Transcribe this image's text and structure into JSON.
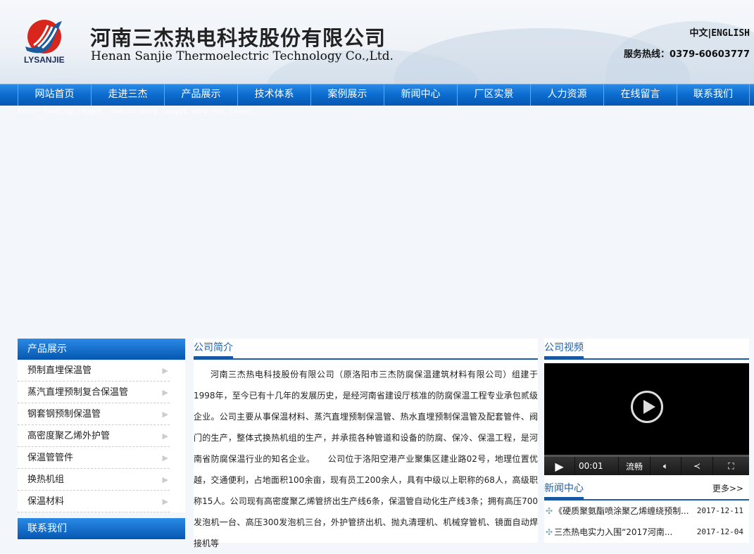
{
  "header": {
    "logo_text": "LYSANJIE",
    "title_cn": "河南三杰热电科技股份有限公司",
    "title_en": "Henan Sanjie Thermoelectric Technology Co.,Ltd.",
    "lang_cn": "中文",
    "lang_sep": "|",
    "lang_en": "ENGLISH",
    "hotline": "服务热线：0379-60603777"
  },
  "nav": [
    "网站首页",
    "走进三杰",
    "产品展示",
    "技术体系",
    "案例展示",
    "新闻中心",
    "厂区实景",
    "人力资源",
    "在线留言",
    "联系我们"
  ],
  "error_text": "Error loading images. One or more images were not found.",
  "products": {
    "title": "产品展示",
    "items": [
      "预制直埋保温管",
      "蒸汽直埋预制复合保温管",
      "钢套钢预制保温管",
      "高密度聚乙烯外护管",
      "保温管管件",
      "换热机组",
      "保温材料"
    ]
  },
  "contact": {
    "title": "联系我们"
  },
  "intro": {
    "title": "公司简介",
    "text": "河南三杰热电科技股份有限公司（原洛阳市三杰防腐保温建筑材料有限公司）组建于1998年，至今已有十几年的发展历史，是经河南省建设厅核准的防腐保温工程专业承包贰级企业。公司主要从事保温材料、蒸汽直埋预制保温管、热水直埋预制保温管及配套管件、阀门的生产，整体式换热机组的生产，并承揽各种管道和设备的防腐、保冷、保温工程，是河南省防腐保温行业的知名企业。　　公司位于洛阳空港产业聚集区建业路02号，地理位置优越，交通便利，占地面积100余亩，现有员工200余人，具有中级以上职称的68人，高级职称15人。公司现有高密度聚乙烯管挤出生产线6条，保温管自动化生产线3条；拥有高压700发泡机一台、高压300发泡机三台，外护管挤出机、抛丸清理机、机械穿管机、镜面自动焊接机等"
  },
  "video": {
    "title": "公司视频",
    "time": "00:01",
    "quality": "流畅"
  },
  "news": {
    "title": "新闻中心",
    "more": "更多>>",
    "items": [
      {
        "title": "《硬质聚氨酯喷涂聚乙烯缠绕预制...",
        "date": "2017-12-11"
      },
      {
        "title": "三杰热电实力入围“2017河南...",
        "date": "2017-12-04"
      }
    ]
  }
}
